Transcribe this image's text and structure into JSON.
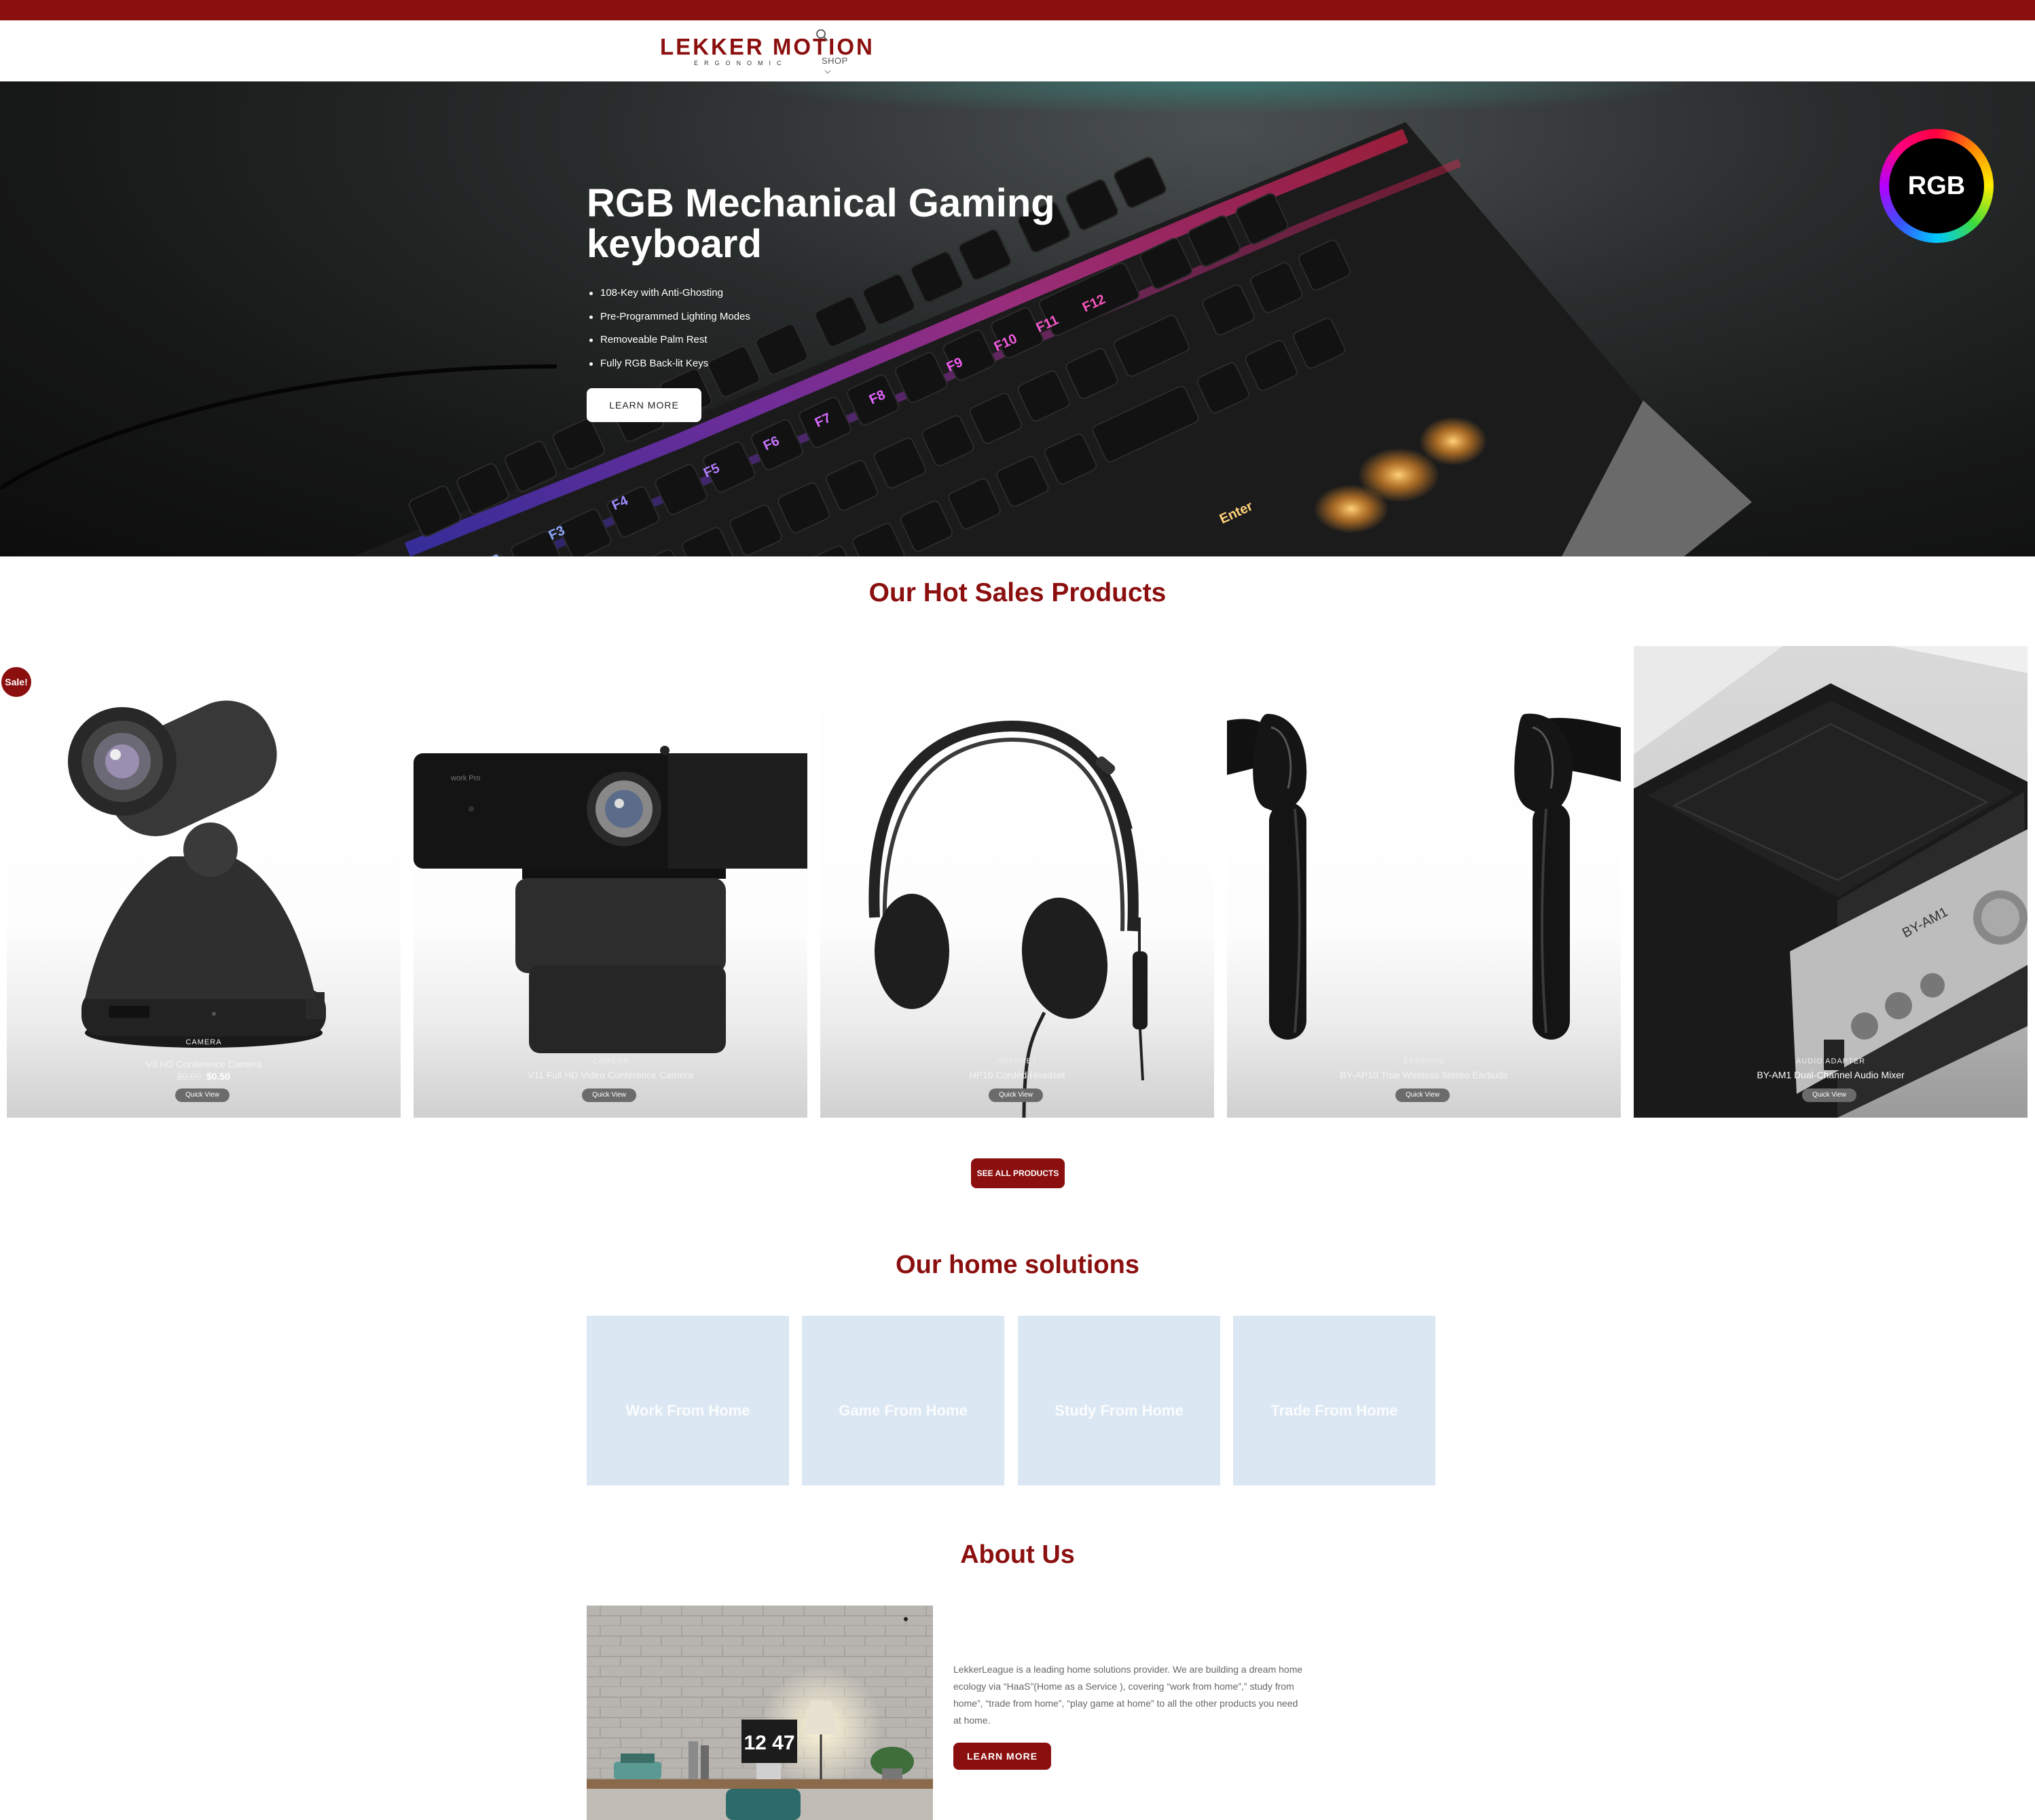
{
  "header": {
    "logo_text": "LEKKER MOTION",
    "logo_subtext": "ERGONOMIC",
    "nav_shop": "SHOP"
  },
  "hero": {
    "title": "RGB Mechanical Gaming keyboard",
    "features": [
      "108-Key with Anti-Ghosting",
      "Pre-Programmed Lighting Modes",
      "Removeable Palm Rest",
      "Fully RGB Back-lit Keys"
    ],
    "button_label": "LEARN MORE",
    "badge_text": "RGB"
  },
  "hot_sales": {
    "title": "Our Hot Sales Products",
    "sale_badge": "Sale!",
    "products": [
      {
        "category": "CAMERA",
        "name": "V3 HD Conference Camera",
        "old_price": "$0.00",
        "price": "$0.50",
        "quick_view": "Quick View"
      },
      {
        "category": "CAMERA",
        "name": "V11 Full HD Video Conference Camera",
        "quick_view": "Quick View"
      },
      {
        "category": "HEADSET",
        "name": "HP10 Corded Headset",
        "quick_view": "Quick View"
      },
      {
        "category": "EARBUDS",
        "name": "BY-AP10 True Wireless Stereo Earbuds",
        "quick_view": "Quick View"
      },
      {
        "category": "AUDIO ADAPTER",
        "name": "BY-AM1 Dual-Channel Audio Mixer",
        "quick_view": "Quick View"
      }
    ],
    "see_all_label": "SEE ALL PRODUCTS"
  },
  "home_solutions": {
    "title": "Our home solutions",
    "tiles": [
      "Work From Home",
      "Game From Home",
      "Study From Home",
      "Trade From Home"
    ]
  },
  "about": {
    "title": "About Us",
    "clock_text": "12 47",
    "text": "LekkerLeague is a leading home solutions provider. We are building a dream home ecology via “HaaS”(Home as a Service ), covering “work from home”,” study from home”, “trade from home”, “play game at home” to all the other products you need at home.",
    "button_label": "LEARN MORE"
  },
  "colors": {
    "brand": "#8b0f0f",
    "tile_bg": "#dbe7f2"
  }
}
